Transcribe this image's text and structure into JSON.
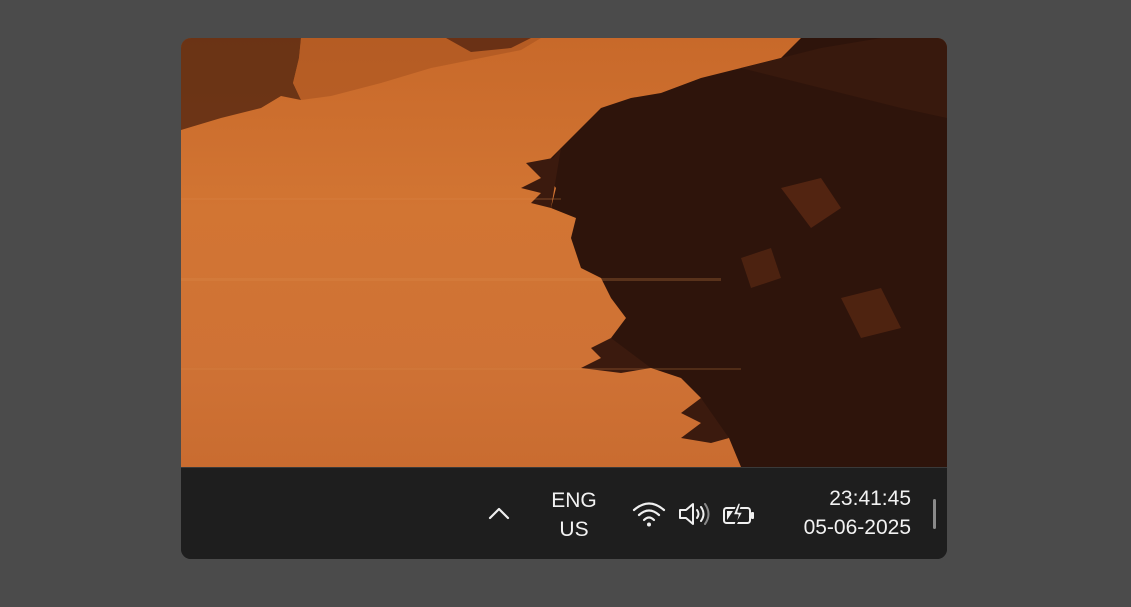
{
  "wallpaper": {
    "description_colors": {
      "sky_water": "#d27533",
      "shadow": "#2a120a"
    }
  },
  "taskbar": {
    "tray_overflow_icon": "chevron-up-icon",
    "language": {
      "line1": "ENG",
      "line2": "US"
    },
    "quick_settings": {
      "wifi_icon": "wifi-icon",
      "volume_icon": "volume-icon",
      "battery_icon": "battery-charging-icon"
    },
    "clock": {
      "time": "23:41:45",
      "date": "05-06-2025"
    }
  }
}
